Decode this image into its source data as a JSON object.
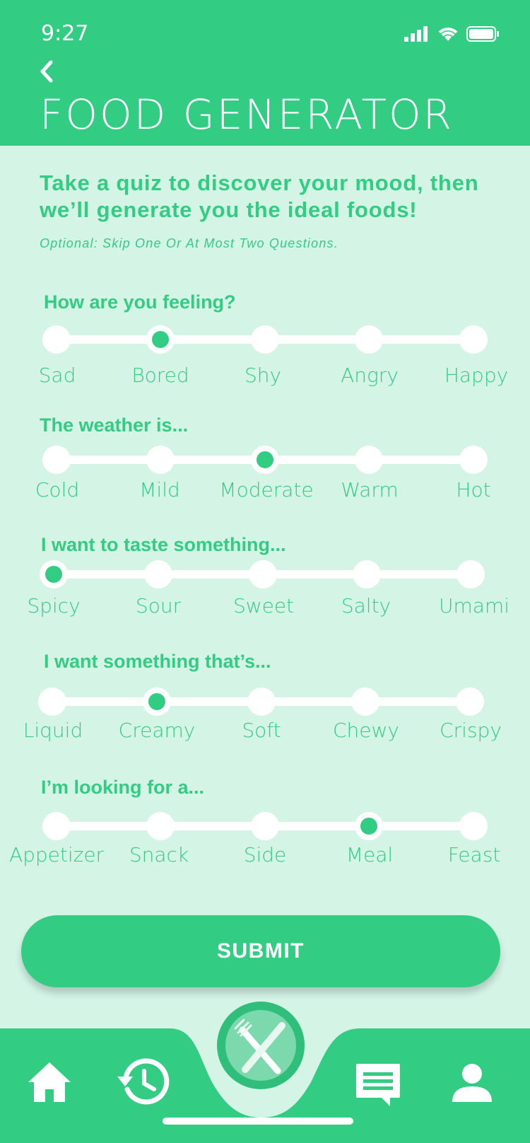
{
  "status_bar": {
    "time": "9:27"
  },
  "header": {
    "title": "FOOD GENERATOR"
  },
  "intro": {
    "line1": "Take a quiz to discover your mood, then",
    "line2": "we’ll generate you the ideal foods!",
    "optional": "Optional: Skip One Or At Most Two Questions."
  },
  "questions": [
    {
      "label": "How are you feeling?",
      "options": [
        "Sad",
        "Bored",
        "Shy",
        "Angry",
        "Happy"
      ],
      "selected": 1
    },
    {
      "label": "The weather is...",
      "options": [
        "Cold",
        "Mild",
        "Moderate",
        "Warm",
        "Hot"
      ],
      "selected": 2
    },
    {
      "label": "I want to taste something...",
      "options": [
        "Spicy",
        "Sour",
        "Sweet",
        "Salty",
        "Umami"
      ],
      "selected": 0
    },
    {
      "label": "I want something that’s...",
      "options": [
        "Liquid",
        "Creamy",
        "Soft",
        "Chewy",
        "Crispy"
      ],
      "selected": 1
    },
    {
      "label": "I’m looking for a...",
      "options": [
        "Appetizer",
        "Snack",
        "Side",
        "Meal",
        "Feast"
      ],
      "selected": 3
    }
  ],
  "submit": {
    "label": "SUBMIT"
  },
  "tabs": [
    "home-icon",
    "history-icon",
    "fork-knife-icon",
    "chat-icon",
    "profile-icon"
  ],
  "colors": {
    "accent": "#33cc83",
    "background": "#d4f4e6"
  }
}
